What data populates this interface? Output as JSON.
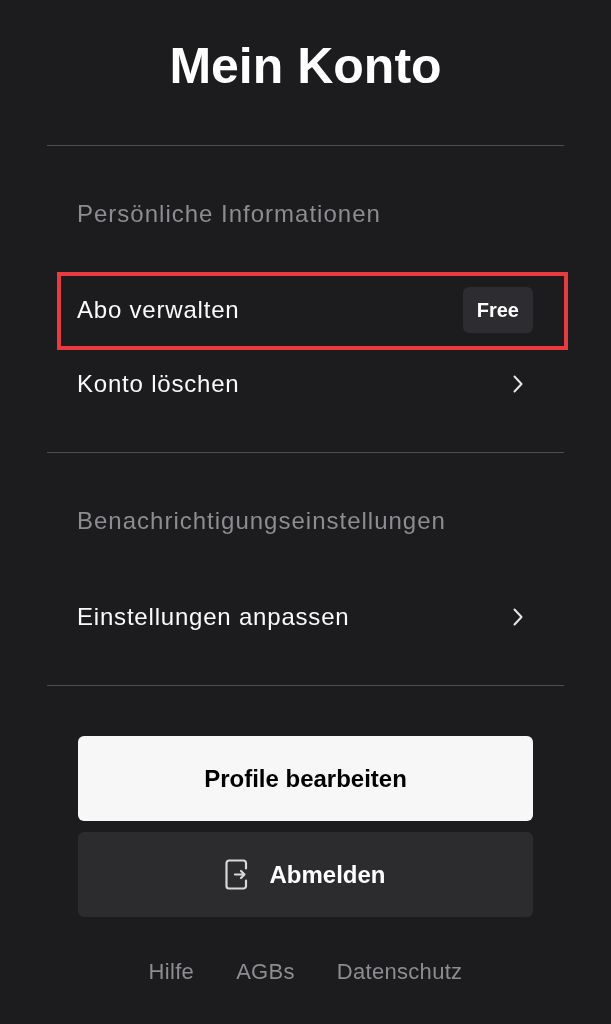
{
  "title": "Mein Konto",
  "sections": [
    {
      "heading": "Persönliche Informationen",
      "items": [
        {
          "label": "Abo verwalten",
          "kind": "badge",
          "badge": "Free",
          "highlighted": true
        },
        {
          "label": "Konto löschen",
          "kind": "link",
          "highlighted": false
        }
      ]
    },
    {
      "heading": "Benachrichtigungseinstellungen",
      "items": [
        {
          "label": "Einstellungen anpassen",
          "kind": "link",
          "highlighted": false
        }
      ]
    }
  ],
  "buttons": [
    {
      "label": "Profile bearbeiten",
      "kind": "primary"
    },
    {
      "label": "Abmelden",
      "kind": "logout"
    }
  ],
  "footer_links": [
    "Hilfe",
    "AGBs",
    "Datenschutz"
  ]
}
